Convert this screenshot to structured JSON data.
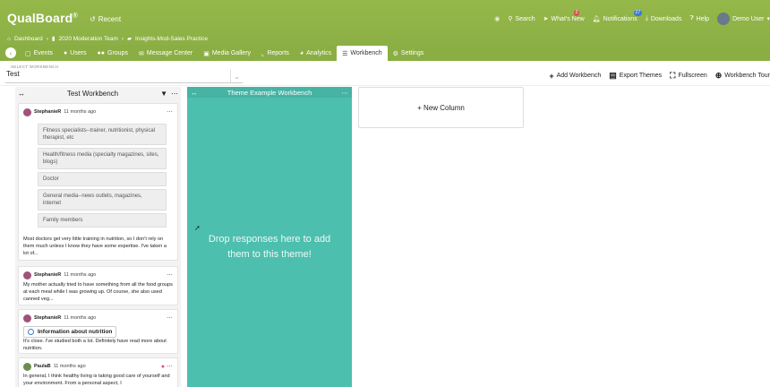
{
  "app": {
    "logo": "QualBoard",
    "logo_mark": "®",
    "recent": "Recent"
  },
  "topnav": {
    "search": "Search",
    "whats_new": "What's New",
    "whats_new_count": "2",
    "notifications": "Notifications",
    "notifications_count": "27",
    "downloads": "Downloads",
    "help": "Help",
    "user": "Demo User"
  },
  "breadcrumb": {
    "dashboard": "Dashboard",
    "team": "2020 Moderation Team",
    "project": "Insights-Mod-Sales Practice"
  },
  "tabs": [
    {
      "label": "Events",
      "icon": "calendar-icon"
    },
    {
      "label": "Users",
      "icon": "user-icon"
    },
    {
      "label": "Groups",
      "icon": "group-icon"
    },
    {
      "label": "Message Center",
      "icon": "envelope-icon"
    },
    {
      "label": "Media Gallery",
      "icon": "media-icon"
    },
    {
      "label": "Reports",
      "icon": "chart-icon"
    },
    {
      "label": "Analytics",
      "icon": "pie-icon"
    },
    {
      "label": "Workbench",
      "icon": "workbench-icon"
    },
    {
      "label": "Settings",
      "icon": "gear-icon"
    }
  ],
  "toolbar": {
    "select_label": "SELECT WORKBENCH",
    "select_value": "Test",
    "add_workbench": "Add Workbench",
    "export_themes": "Export Themes",
    "fullscreen": "Fullscreen",
    "workbench_tour": "Workbench Tour"
  },
  "col1": {
    "title": "Test Workbench",
    "cards": [
      {
        "author": "StephanieR",
        "time": "11 months ago",
        "options": [
          "Fitness specialists--trainer, nutritionist, physical therapist, etc",
          "Health/fitness media (specialty magazines, sites, blogs)",
          "Doctor",
          "General media--news outlets, magazines, internet",
          "Family members"
        ],
        "text": "Most doctors get very little training in nutrition, so I don't rely on them much unless I know they have some expertise. I've taken a lot of..."
      },
      {
        "author": "StephanieR",
        "time": "11 months ago",
        "text": "My mother actually tried to have something from all the food groups at each meal while I was growing up. Of course, she also used canned veg..."
      },
      {
        "author": "StephanieR",
        "time": "11 months ago",
        "chip": "Information about nutrition",
        "text": "It's close. I've studied both a lot. Definitely have read more about nutrition."
      },
      {
        "author": "PaulaB",
        "time": "11 months ago",
        "text": "In general, I think healthy living is taking good care of yourself and your environment. From a personal aspect, I"
      }
    ]
  },
  "col2": {
    "title": "Theme Example Workbench",
    "drop_text": "Drop responses here to add them to this theme!"
  },
  "col3": {
    "label": "+ New Column"
  },
  "colors": {
    "brand_green": "#8aae44",
    "theme_teal": "#4dbfae"
  }
}
